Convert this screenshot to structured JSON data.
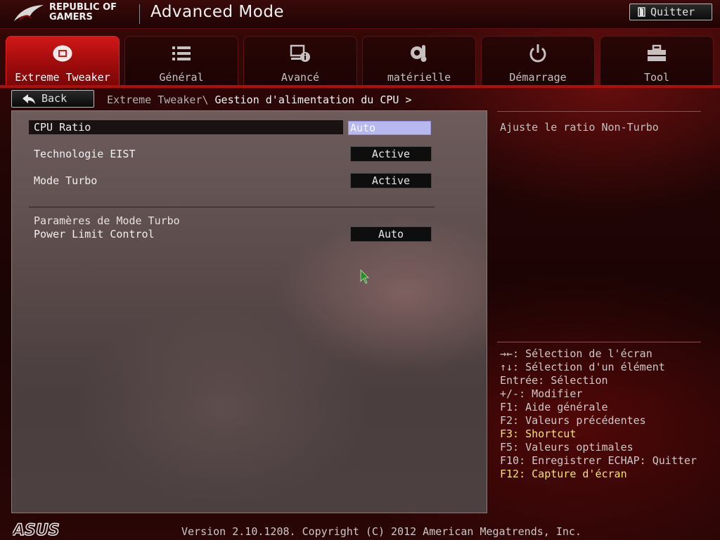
{
  "header": {
    "brand_line1": "REPUBLIC OF",
    "brand_line2": "GAMERS",
    "title": "Advanced Mode",
    "quit_label": "Quitter"
  },
  "tabs": [
    {
      "label": "Extreme Tweaker",
      "icon": "cpu-fan-icon",
      "active": true
    },
    {
      "label": "Général",
      "icon": "list-icon",
      "active": false
    },
    {
      "label": "Avancé",
      "icon": "advanced-info-icon",
      "active": false
    },
    {
      "label": "matérielle",
      "icon": "thermometer-gear-icon",
      "active": false
    },
    {
      "label": "Démarrage",
      "icon": "power-icon",
      "active": false
    },
    {
      "label": "Tool",
      "icon": "toolbox-icon",
      "active": false
    }
  ],
  "nav": {
    "back_label": "Back",
    "breadcrumb_parent": "Extreme Tweaker\\",
    "breadcrumb_current": " Gestion d'alimentation du CPU >"
  },
  "settings": [
    {
      "label": "CPU Ratio",
      "value": "Auto",
      "selected": true
    },
    {
      "label": "Technologie EIST",
      "value": "Active",
      "selected": false
    },
    {
      "label": "Mode Turbo",
      "value": "Active",
      "selected": false
    }
  ],
  "turbo_section": {
    "heading": "Paramères de Mode Turbo",
    "item_label": "Power Limit Control",
    "item_value": "Auto"
  },
  "help": {
    "description": "Ajuste le ratio Non-Turbo",
    "shortcuts": [
      "→←: Sélection de l'écran",
      "↑↓: Sélection d'un élément",
      "Entrée: Sélection",
      "+/-: Modifier",
      "F1: Aide générale",
      "F2: Valeurs précédentes",
      "F3: Shortcut",
      "F5: Valeurs optimales",
      "F10: Enregistrer  ECHAP: Quitter",
      "F12: Capture d'écran"
    ]
  },
  "footer": {
    "logo_text": "ASUS",
    "version_text": "Version 2.10.1208. Copyright (C) 2012 American Megatrends, Inc."
  },
  "colors": {
    "accent_red": "#b00e0e",
    "active_tab": "#d01818",
    "highlight_text": "#f4e46a",
    "selected_value_bg": "#b8b8f0"
  }
}
